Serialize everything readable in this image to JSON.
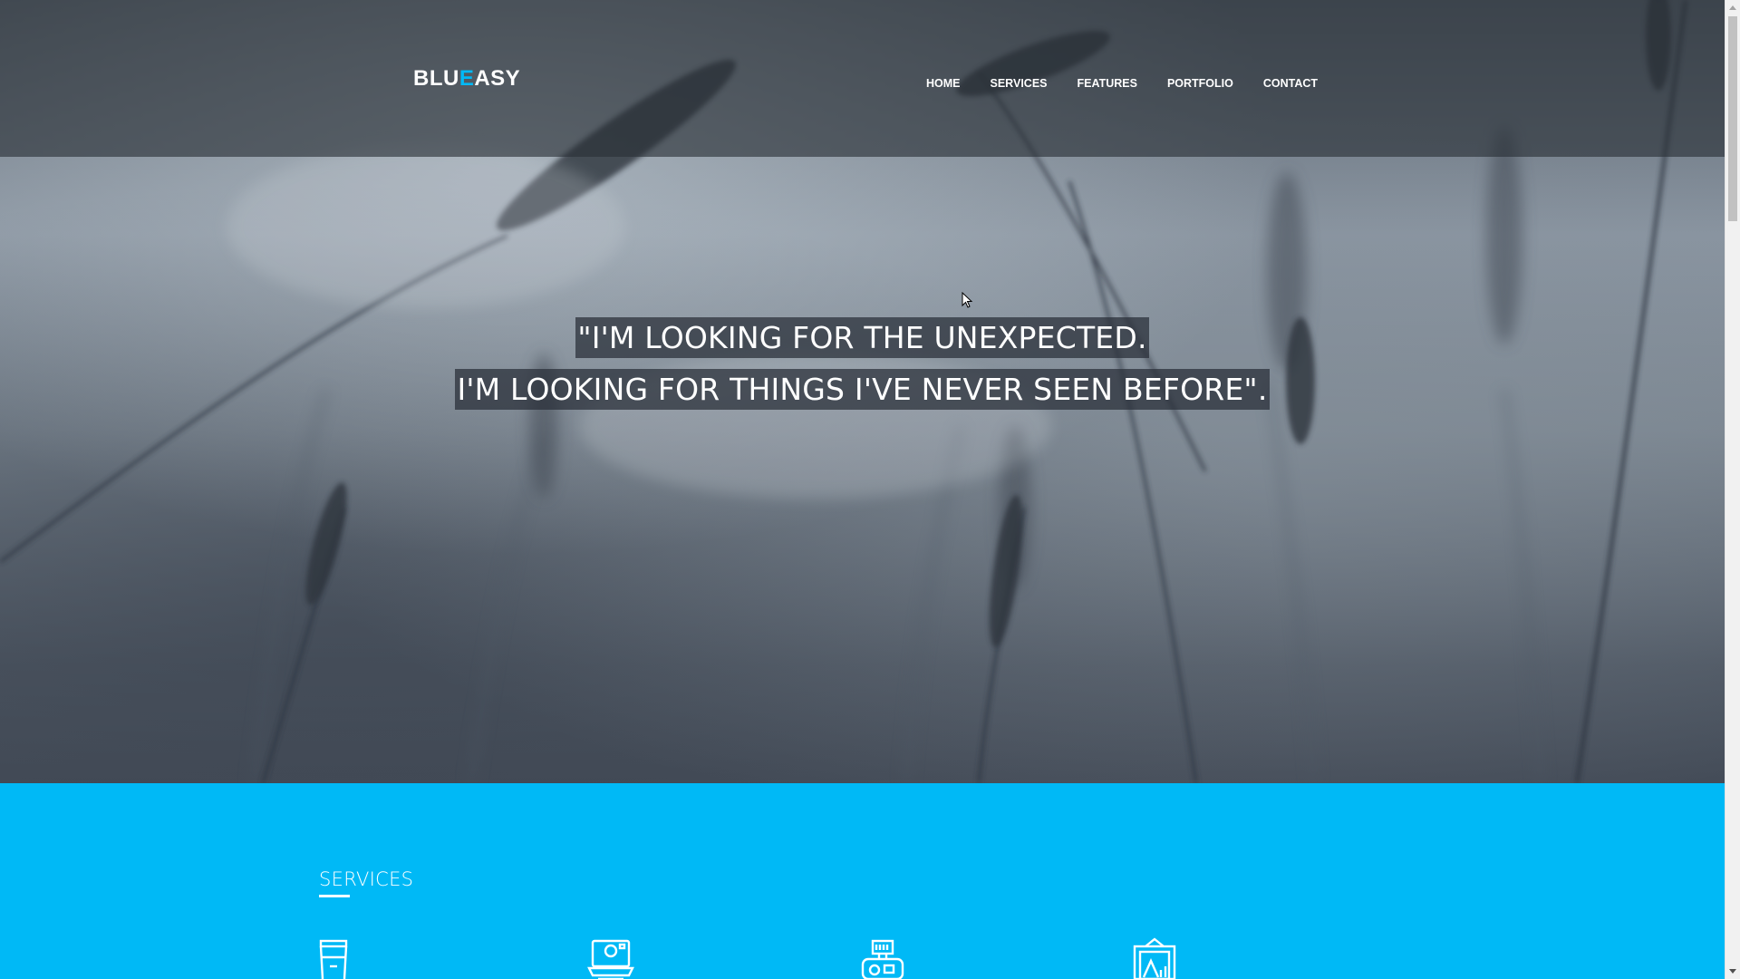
{
  "header": {
    "logo": {
      "part1": "BLU",
      "accent": "E",
      "part2": "ASY"
    },
    "nav": [
      {
        "label": "HOME"
      },
      {
        "label": "SERVICES"
      },
      {
        "label": "FEATURES"
      },
      {
        "label": "PORTFOLIO"
      },
      {
        "label": "CONTACT"
      }
    ]
  },
  "hero": {
    "quote_line_1": "\"I'M LOOKING FOR THE UNEXPECTED.",
    "quote_line_2": "I'M LOOKING FOR THINGS I'VE NEVER SEEN BEFORE\"."
  },
  "services": {
    "title": "SERVICES",
    "icons": [
      "coffee-cup-icon",
      "polaroid-camera-icon",
      "camera-gear-icon",
      "picture-frame-icon"
    ]
  },
  "colors": {
    "accent": "#00b9f6",
    "navbar_overlay": "#282e36",
    "text": "#ffffff"
  }
}
